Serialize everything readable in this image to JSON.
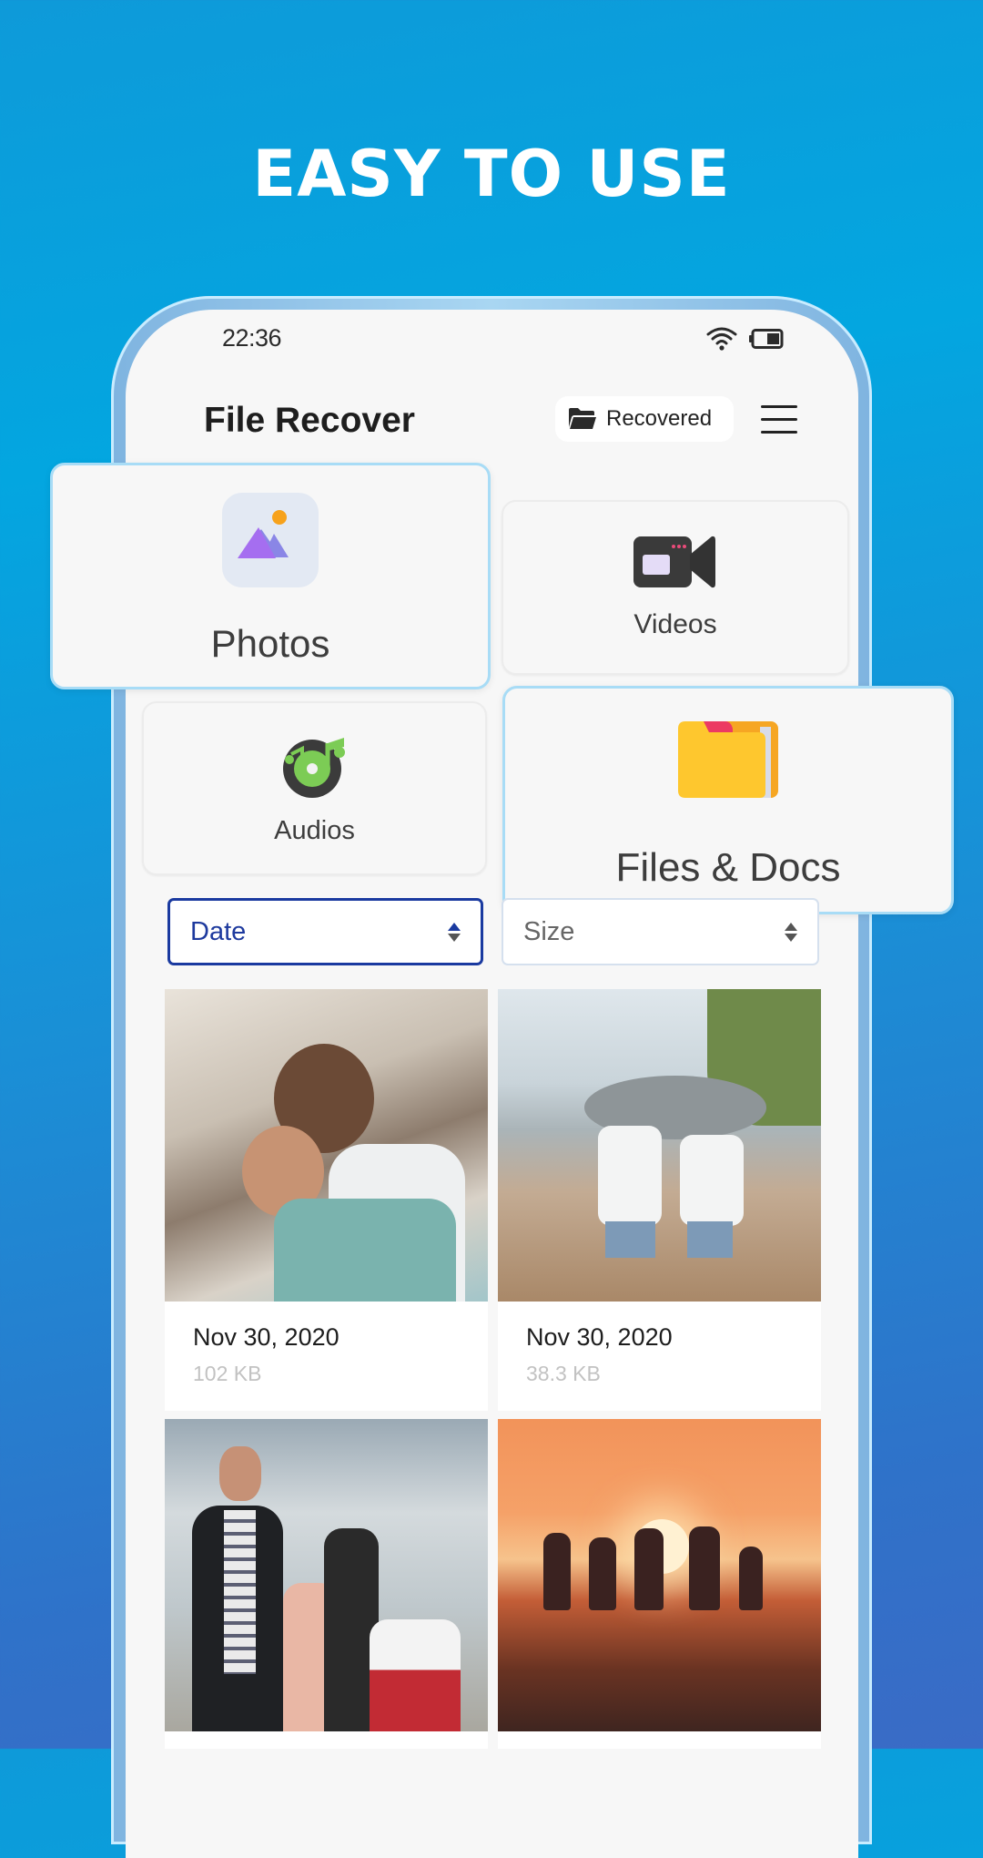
{
  "headline": "EASY TO USE",
  "status_bar": {
    "time": "22:36",
    "wifi_icon": "wifi-icon",
    "battery_icon": "battery-half-icon"
  },
  "header": {
    "title": "File Recover",
    "recovered_button": {
      "label": "Recovered",
      "icon": "folder-open-icon"
    },
    "menu_icon": "hamburger-menu-icon"
  },
  "categories": [
    {
      "label": "Photos",
      "icon": "photo-landscape-icon"
    },
    {
      "label": "Videos",
      "icon": "video-camera-icon"
    },
    {
      "label": "Audios",
      "icon": "music-disc-icon"
    },
    {
      "label": "Files & Docs",
      "icon": "folder-icon"
    }
  ],
  "sort": {
    "primary": {
      "value": "Date"
    },
    "secondary": {
      "value": "Size"
    }
  },
  "photos": [
    {
      "date": "Nov 30, 2020",
      "size": "102 KB",
      "subject": "mother hugging child on beach"
    },
    {
      "date": "Nov 30, 2020",
      "size": "38.3 KB",
      "subject": "two kids running on beach under blanket"
    },
    {
      "subject": "family portrait on beach"
    },
    {
      "subject": "family silhouettes at sunset"
    }
  ],
  "colors": {
    "accent": "#1a3aa0",
    "background_top": "#03a6e0",
    "background_bottom": "#3a6bc6",
    "highlight_border": "#a8dcf6"
  }
}
